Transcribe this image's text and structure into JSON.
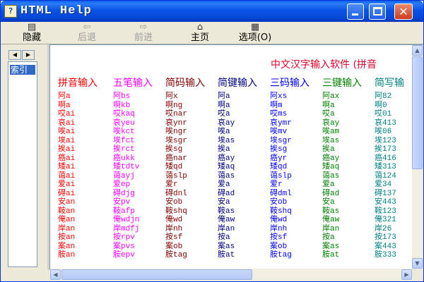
{
  "window": {
    "title": "HTML Help",
    "app_icon": "help-book-icon",
    "controls": {
      "minimize": "",
      "maximize": "",
      "close": "✕"
    }
  },
  "toolbar": {
    "hide": {
      "label": "隐藏",
      "icon": "hide-pane-icon",
      "glyph": "▤"
    },
    "back": {
      "label": "后退",
      "icon": "back-arrow-icon",
      "glyph": "⇦"
    },
    "forward": {
      "label": "前进",
      "icon": "forward-arrow-icon",
      "glyph": "⇨"
    },
    "home": {
      "label": "主页",
      "icon": "home-icon",
      "glyph": "⌂"
    },
    "options": {
      "label": "选项(O)",
      "icon": "options-icon",
      "glyph": "▦"
    }
  },
  "navpane": {
    "tab_left": "◀",
    "tab_right": "▶",
    "active_tab": "索引"
  },
  "document": {
    "title": "中文汉字输入软件 (拼音",
    "columns": [
      {
        "header": "拼音输入",
        "color": "#ff0000",
        "rows": [
          "阿a",
          "啊a",
          "哎ai",
          "哀ai",
          "唉ai",
          "埃ai",
          "挨ai",
          "癌ai",
          "矮ai",
          "蔼ai",
          "爱ai",
          "碍ai",
          "安an",
          "鞍an",
          "俺an",
          "岸an",
          "按an",
          "案an",
          "胺an"
        ]
      },
      {
        "header": "五笔输入",
        "color": "#ff00ff",
        "rows": [
          "阿bs",
          "啊kb",
          "哎kaq",
          "哀yeu",
          "唉kct",
          "埃fct",
          "挨rct",
          "癌ukk",
          "矮tdtv",
          "蔼ayj",
          "爱ep",
          "碍djg",
          "安pv",
          "鞍afp",
          "俺wdjn",
          "岸mdfj",
          "按rpv",
          "案pvs",
          "胺epv"
        ]
      },
      {
        "header": "简码输入",
        "color": "#800000",
        "rows": [
          "阿x",
          "啊ng",
          "哎nar",
          "哀ynr",
          "唉ngr",
          "埃sgr",
          "挨sg",
          "癌nar",
          "矮qd",
          "蔼slp",
          "爱r",
          "碍dnl",
          "安ob",
          "鞍shq",
          "俺wd",
          "岸nh",
          "按sf",
          "案ob",
          "胺tag"
        ]
      },
      {
        "header": "简键输入",
        "color": "#000080",
        "rows": [
          "阿a",
          "啊a",
          "哎a",
          "哀ay",
          "唉a",
          "埃as",
          "挨a",
          "癌ay",
          "矮aq",
          "蔼as",
          "爱a",
          "碍ad",
          "安a",
          "鞍as",
          "俺aw",
          "岸an",
          "按a",
          "案as",
          "胺at"
        ]
      },
      {
        "header": "三码输入",
        "color": "#0000ff",
        "rows": [
          "阿xs",
          "啊m",
          "哎ms",
          "哀ymr",
          "唉mv",
          "埃sgr",
          "挨sg",
          "癌yr",
          "矮qd",
          "蔼slp",
          "爱r",
          "碍dml",
          "安ob",
          "鞍shq",
          "俺wd",
          "岸nh",
          "按sf",
          "案ob",
          "胺tag"
        ]
      },
      {
        "header": "三键输入",
        "color": "#008000",
        "rows": [
          "阿ax",
          "啊a",
          "哎a",
          "哀ay",
          "唉am",
          "埃as",
          "挨a",
          "癌ay",
          "矮aq",
          "蔼as",
          "爱a",
          "碍ad",
          "安a",
          "鞍as",
          "俺aw",
          "岸an",
          "按a",
          "案as",
          "胺at"
        ]
      },
      {
        "header": "简写输",
        "color": "#008080",
        "rows": [
          "阿82",
          "啊0",
          "哎01",
          "哀413",
          "唉06",
          "埃123",
          "挨173",
          "癌416",
          "矮313",
          "蔼124",
          "爱34",
          "碍137",
          "安443",
          "鞍123",
          "俺321",
          "岸26",
          "按173",
          "案443",
          "胺333"
        ]
      }
    ]
  }
}
